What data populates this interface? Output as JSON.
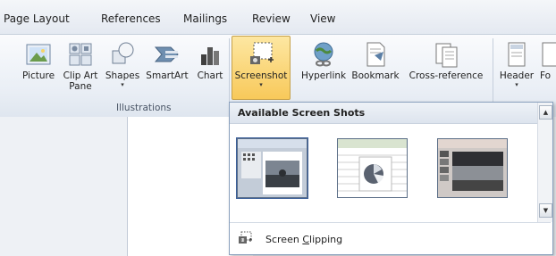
{
  "tabs": [
    "Page Layout",
    "References",
    "Mailings",
    "Review",
    "View"
  ],
  "ribbon": {
    "buttons": [
      {
        "id": "picture",
        "label": "Picture",
        "icon": "picture-icon"
      },
      {
        "id": "clipart",
        "label": "Clip Art",
        "label2": "Pane",
        "icon": "clip-art-icon"
      },
      {
        "id": "shapes",
        "label": "Shapes",
        "icon": "shapes-icon",
        "has_dropdown": true
      },
      {
        "id": "smartart",
        "label": "SmartArt",
        "icon": "smartart-icon"
      },
      {
        "id": "chart",
        "label": "Chart",
        "icon": "chart-icon"
      },
      {
        "id": "screenshot",
        "label": "Screenshot",
        "icon": "screenshot-icon",
        "has_dropdown": true,
        "active": true
      },
      {
        "id": "hyperlink",
        "label": "Hyperlink",
        "icon": "hyperlink-icon"
      },
      {
        "id": "bookmark",
        "label": "Bookmark",
        "icon": "bookmark-icon"
      },
      {
        "id": "crossref",
        "label": "Cross-reference",
        "icon": "cross-reference-icon"
      },
      {
        "id": "header",
        "label": "Header",
        "icon": "header-icon",
        "has_dropdown": true
      },
      {
        "id": "footer",
        "label": "Fo",
        "icon": "footer-icon"
      }
    ],
    "group_label": "Illustrations",
    "dropdown_arrow": "▾"
  },
  "screenshot_menu": {
    "title": "Available Screen Shots",
    "thumbnail_icons": [
      "word-window-thumbnail",
      "excel-window-thumbnail",
      "powerpoint-window-thumbnail"
    ],
    "clipping_label_pre": "Screen ",
    "clipping_label_underlined": "C",
    "clipping_label_post": "lipping",
    "scroll_up": "▲",
    "scroll_down": "▼"
  },
  "colors": {
    "active_button": "#f8c95a",
    "dropdown_border": "#8aa0bd"
  }
}
